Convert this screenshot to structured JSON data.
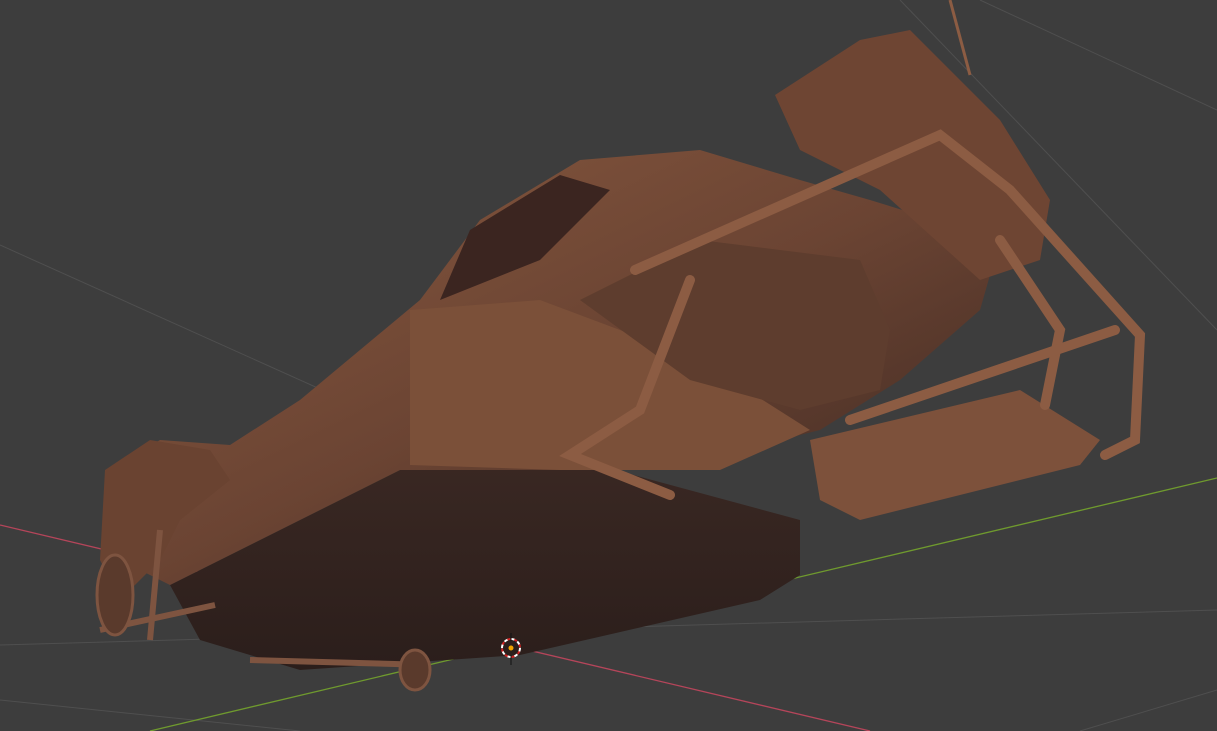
{
  "viewport": {
    "mode": "3d-viewport",
    "background_color": "#3d3d3d",
    "grid_color": "#555555",
    "x_axis_color": "#b5455a",
    "y_axis_color": "#6f9a2e",
    "model_color": "#7a4e38",
    "cursor_icon": "3d-cursor-icon",
    "origin_color": "#f2a300"
  }
}
